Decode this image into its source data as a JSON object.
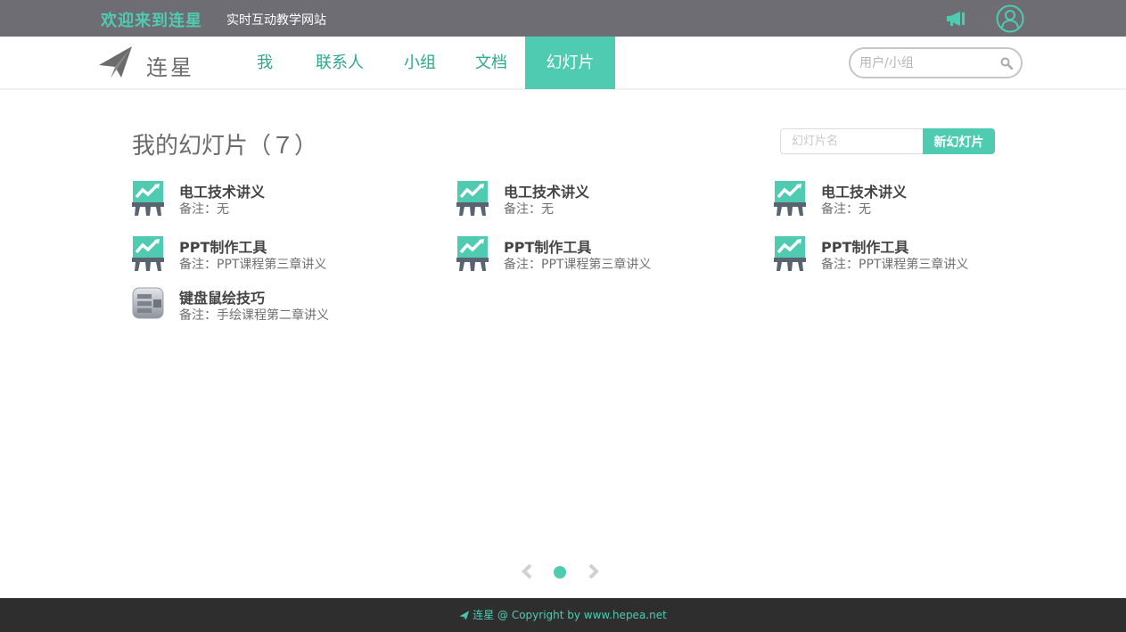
{
  "topbar": {
    "welcome": "欢迎来到连星",
    "tagline": "实时互动教学网站",
    "icons": [
      "megaphone-icon",
      "user-avatar-icon"
    ]
  },
  "brand": {
    "name": "连星",
    "icon": "paper-plane-icon"
  },
  "nav": {
    "items": [
      {
        "label": "我"
      },
      {
        "label": "联系人"
      },
      {
        "label": "小组"
      },
      {
        "label": "文档"
      },
      {
        "label": "幻灯片",
        "active": true
      }
    ]
  },
  "search": {
    "placeholder": "用户/小组"
  },
  "main": {
    "title": "我的幻灯片（７）",
    "new_input_placeholder": "幻灯片名",
    "new_button": "新幻灯片"
  },
  "slides": [
    {
      "name": "电工技术讲义",
      "note": "备注：无",
      "icon": "presentation-chart-icon"
    },
    {
      "name": "电工技术讲义",
      "note": "备注：无",
      "icon": "presentation-chart-icon"
    },
    {
      "name": "电工技术讲义",
      "note": "备注：无",
      "icon": "presentation-chart-icon"
    },
    {
      "name": "PPT制作工具",
      "note": "备注：PPT课程第三章讲义",
      "icon": "presentation-chart-icon"
    },
    {
      "name": "PPT制作工具",
      "note": "备注：PPT课程第三章讲义",
      "icon": "presentation-chart-icon"
    },
    {
      "name": "PPT制作工具",
      "note": "备注：PPT课程第三章讲义",
      "icon": "presentation-chart-icon"
    },
    {
      "name": "键盘鼠绘技巧",
      "note": "备注：手绘课程第二章讲义",
      "icon": "keyboard-app-icon"
    }
  ],
  "pager": {
    "current_page": 1,
    "total_pages": 1
  },
  "footer": {
    "text": "连星 @ Copyright by www.hepea.net"
  },
  "colors": {
    "accent": "#4ecbb1",
    "topbar": "#6e6d73",
    "footer": "#2e2e2e",
    "icon_dark": "#5a6470"
  }
}
